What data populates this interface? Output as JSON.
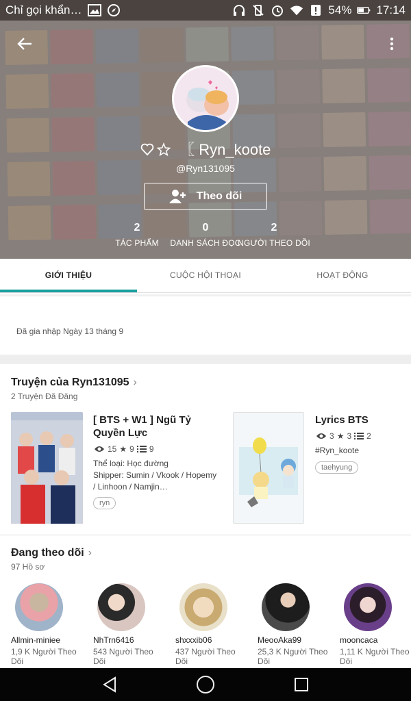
{
  "status_bar": {
    "app_name": "Chỉ gọi khẩn…",
    "battery": "54%",
    "time": "17:14"
  },
  "profile": {
    "display_name": "〖 Ryn_koote",
    "handle": "@Ryn131095",
    "follow_label": "Theo dõi",
    "stats": [
      {
        "value": "2",
        "label": "TÁC PHẨM"
      },
      {
        "value": "0",
        "label": "DANH SÁCH ĐỌC"
      },
      {
        "value": "2",
        "label": "NGƯỜI THEO DÕI"
      }
    ]
  },
  "tabs": [
    {
      "label": "GIỚI THIỆU"
    },
    {
      "label": "CUỘC HỘI THOẠI"
    },
    {
      "label": "HOẠT ĐỘNG"
    }
  ],
  "about": {
    "joined": "Đã gia nhập Ngày 13 tháng 9"
  },
  "stories_section": {
    "title": "Truyện của Ryn131095",
    "subtitle": "2 Truyện Đã Đăng",
    "items": [
      {
        "title_line1": "[ BTS + W1 ] Ngũ Tỷ",
        "title_line2": "Quyền Lực",
        "reads": "15",
        "votes": "9",
        "parts": "9",
        "genre": "Thể loại: Học đường",
        "desc_line1": "Shipper: Sumin / Vkook / Hopemy",
        "desc_line2": "/ Linhoon / Namjin…",
        "tag": "ryn"
      },
      {
        "title_line1": "Lyrics BTS",
        "reads": "3",
        "votes": "3",
        "parts": "2",
        "hashtag": "#Ryn_koote",
        "tag": "taehyung"
      }
    ]
  },
  "following_section": {
    "title": "Đang theo dõi",
    "subtitle": "97 Hồ sơ",
    "people": [
      {
        "name": "Allmin-miniee",
        "followers_line1": "1,9 K Người Theo",
        "followers_line2": "Dõi"
      },
      {
        "name": "NhTrn6416",
        "followers_line1": "543 Người Theo",
        "followers_line2": "Dõi"
      },
      {
        "name": "shxxxib06",
        "followers_line1": "437 Người Theo",
        "followers_line2": "Dõi"
      },
      {
        "name": "MeooAka99",
        "followers_line1": "25,3 K Người Theo",
        "followers_line2": "Dõi"
      },
      {
        "name": "mooncaca",
        "followers_line1": "1,11 K Người Theo",
        "followers_line2": "Dõi"
      }
    ]
  },
  "icons": {
    "back": "arrow-left-icon",
    "more": "more-vertical-icon",
    "heart": "heart-outline-icon",
    "star": "star-outline-icon",
    "add_user": "add-user-icon"
  },
  "colors": {
    "accent": "#1aa0a0",
    "statusbar": "#4a4340",
    "navbar": "#050505"
  }
}
